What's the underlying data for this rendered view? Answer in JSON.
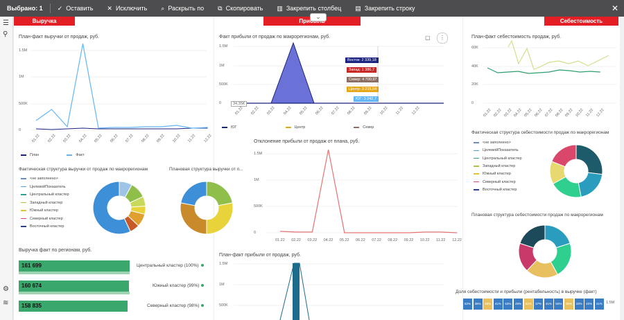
{
  "toolbar": {
    "selected": "Выбрано: 1",
    "keep": "Оставить",
    "exclude": "Исключить",
    "drill": "Раскрыть по",
    "copy": "Скопировать",
    "pin_col": "Закрепить столбец",
    "pin_row": "Закрепить строку",
    "close": "✕"
  },
  "headers": {
    "revenue": "Выручка",
    "profit": "Прибыль",
    "cost": "Себестоимость"
  },
  "months": [
    "01.22",
    "02.22",
    "03.22",
    "04.22",
    "05.22",
    "06.22",
    "07.22",
    "08.22",
    "09.22",
    "10.22",
    "11.22",
    "12.22"
  ],
  "rev_chart": {
    "title": "План-факт выручки от продаж, руб.",
    "yticks": [
      "1.5M",
      "1M",
      "500K",
      "0"
    ],
    "legend": [
      "План",
      "Факт"
    ]
  },
  "profit_chart": {
    "title": "Факт прибыли от продаж по макрорегионам, руб.",
    "yticks": [
      "1.5M",
      "1M",
      "500K",
      "0"
    ],
    "legend": [
      "ЮГ",
      "Центр",
      "Север"
    ],
    "label": "34,35K",
    "tips": [
      "Восток: 2 339,18",
      "Запад: 1 386,7",
      "Север: 4 700,97",
      "Центр: 3 215,04",
      "ЮГ: 3 242,7"
    ]
  },
  "cost_chart": {
    "title": "План-факт себестоимость продаж, руб.",
    "yticks": [
      "60K",
      "40K",
      "20K",
      "0"
    ]
  },
  "dev_chart": {
    "title": "Отклонение прибыли от продаж от плана, руб.",
    "yticks": [
      "1.5M",
      "1M",
      "500K",
      "0"
    ]
  },
  "rev_fact_struct": {
    "title": "Фактическая структура выручки от продаж по макрорегионам"
  },
  "rev_plan_struct": {
    "title": "Плановая структура выручки от п..."
  },
  "cost_fact_struct": {
    "title": "Фактическая структура себестоимости продаж по макрорегионам"
  },
  "cost_plan_struct": {
    "title": "Плановая структура себестоимости продаж по макрорегионам"
  },
  "regions_legend": [
    "<не заполнено>",
    "ЦелевойПоказатель",
    "Центральный кластер",
    "Западный кластер",
    "Южный кластер",
    "Северный кластер",
    "Восточный кластер"
  ],
  "region_colors": [
    "#6c8ebf",
    "#4aa3df",
    "#2e9e8f",
    "#a8c64a",
    "#e5c13a",
    "#d9486b",
    "#2c3e8f"
  ],
  "rev_by_region": {
    "title": "Выручка факт по регионам, руб.",
    "rows": [
      {
        "value": "161 699",
        "label": "Центральный кластер (100%)"
      },
      {
        "value": "160 674",
        "label": "Южный кластер (99%)"
      },
      {
        "value": "158 835",
        "label": "Северный кластер (98%)"
      }
    ]
  },
  "profit_pf": {
    "title": "План-факт прибыли от продаж, руб.",
    "yticks": [
      "1.5M",
      "1M",
      "500K"
    ]
  },
  "share_chart": {
    "title": "Доля себестоимости и прибыли (рентабельность) в выручке (факт)",
    "ytick": "1.5M",
    "cells": [
      "52%",
      "38%",
      "48%",
      "41%",
      "53%",
      "49%",
      "51%",
      "37%",
      "41%",
      "50%",
      "39%",
      "43%",
      "40%",
      "41%"
    ]
  }
}
